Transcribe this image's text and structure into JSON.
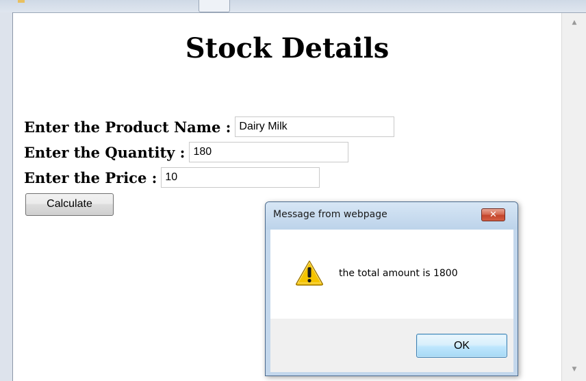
{
  "page": {
    "title": "Stock Details"
  },
  "form": {
    "product_name_label": "Enter the Product Name :",
    "product_name_value": "Dairy Milk",
    "quantity_label": "Enter the Quantity :",
    "quantity_value": "180",
    "price_label": "Enter the Price :",
    "price_value": "10",
    "calculate_label": "Calculate"
  },
  "dialog": {
    "title": "Message from webpage",
    "close_glyph": "✕",
    "icon": "warning-icon",
    "message": "the total amount is 1800",
    "ok_label": "OK"
  },
  "scrollbar": {
    "up_glyph": "▲",
    "down_glyph": "▼"
  },
  "colors": {
    "dialog_close": "#c4452b",
    "ok_button_border": "#3c7fb1",
    "warning_yellow": "#f5c400"
  }
}
